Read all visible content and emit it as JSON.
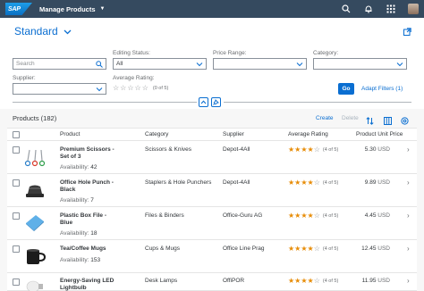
{
  "shell": {
    "logo": "SAP",
    "title": "Manage Products"
  },
  "variant": {
    "title": "Standard"
  },
  "filters": {
    "search": {
      "label": "",
      "placeholder": "Search"
    },
    "editing_status": {
      "label": "Editing Status:",
      "value": "All"
    },
    "price_range": {
      "label": "Price Range:",
      "value": ""
    },
    "category": {
      "label": "Category:",
      "value": ""
    },
    "supplier": {
      "label": "Supplier:",
      "value": ""
    },
    "average_rating": {
      "label": "Average Rating:",
      "count": "(0 of 5)"
    },
    "go_label": "Go",
    "adapt_label": "Adapt Filters (1)"
  },
  "table": {
    "title": "Products (182)",
    "create_label": "Create",
    "delete_label": "Delete",
    "columns": [
      "Product",
      "Category",
      "Supplier",
      "Average Rating",
      "Product Unit Price"
    ],
    "availability_label": "Availability:",
    "rows": [
      {
        "name": "Premium Scissors - Set of 3",
        "availability": "42",
        "category": "Scissors & Knives",
        "supplier": "Depot-4All",
        "rating": 4,
        "rating_text": "(4 of 5)",
        "price": "5.30",
        "currency": "USD",
        "thumb": "scissors"
      },
      {
        "name": "Office Hole Punch - Black",
        "availability": "7",
        "category": "Staplers & Hole Punchers",
        "supplier": "Depot-4All",
        "rating": 4,
        "rating_text": "(4 of 5)",
        "price": "9.89",
        "currency": "USD",
        "thumb": "hole-punch"
      },
      {
        "name": "Plastic Box File - Blue",
        "availability": "18",
        "category": "Files & Binders",
        "supplier": "Office-Guru AG",
        "rating": 4,
        "rating_text": "(4 of 5)",
        "price": "4.45",
        "currency": "USD",
        "thumb": "box-file"
      },
      {
        "name": "Tea/Coffee Mugs",
        "availability": "153",
        "category": "Cups & Mugs",
        "supplier": "Office Line Prag",
        "rating": 4,
        "rating_text": "(4 of 5)",
        "price": "12.45",
        "currency": "USD",
        "thumb": "mug"
      },
      {
        "name": "Energy-Saving LED Lightbulb",
        "availability": "",
        "category": "Desk Lamps",
        "supplier": "OffiPOR",
        "rating": 4,
        "rating_text": "(4 of 5)",
        "price": "11.95",
        "currency": "USD",
        "thumb": "lightbulb"
      }
    ]
  },
  "colors": {
    "shell": "#354a5f",
    "accent": "#0a6ed1",
    "star": "#e78c07"
  }
}
